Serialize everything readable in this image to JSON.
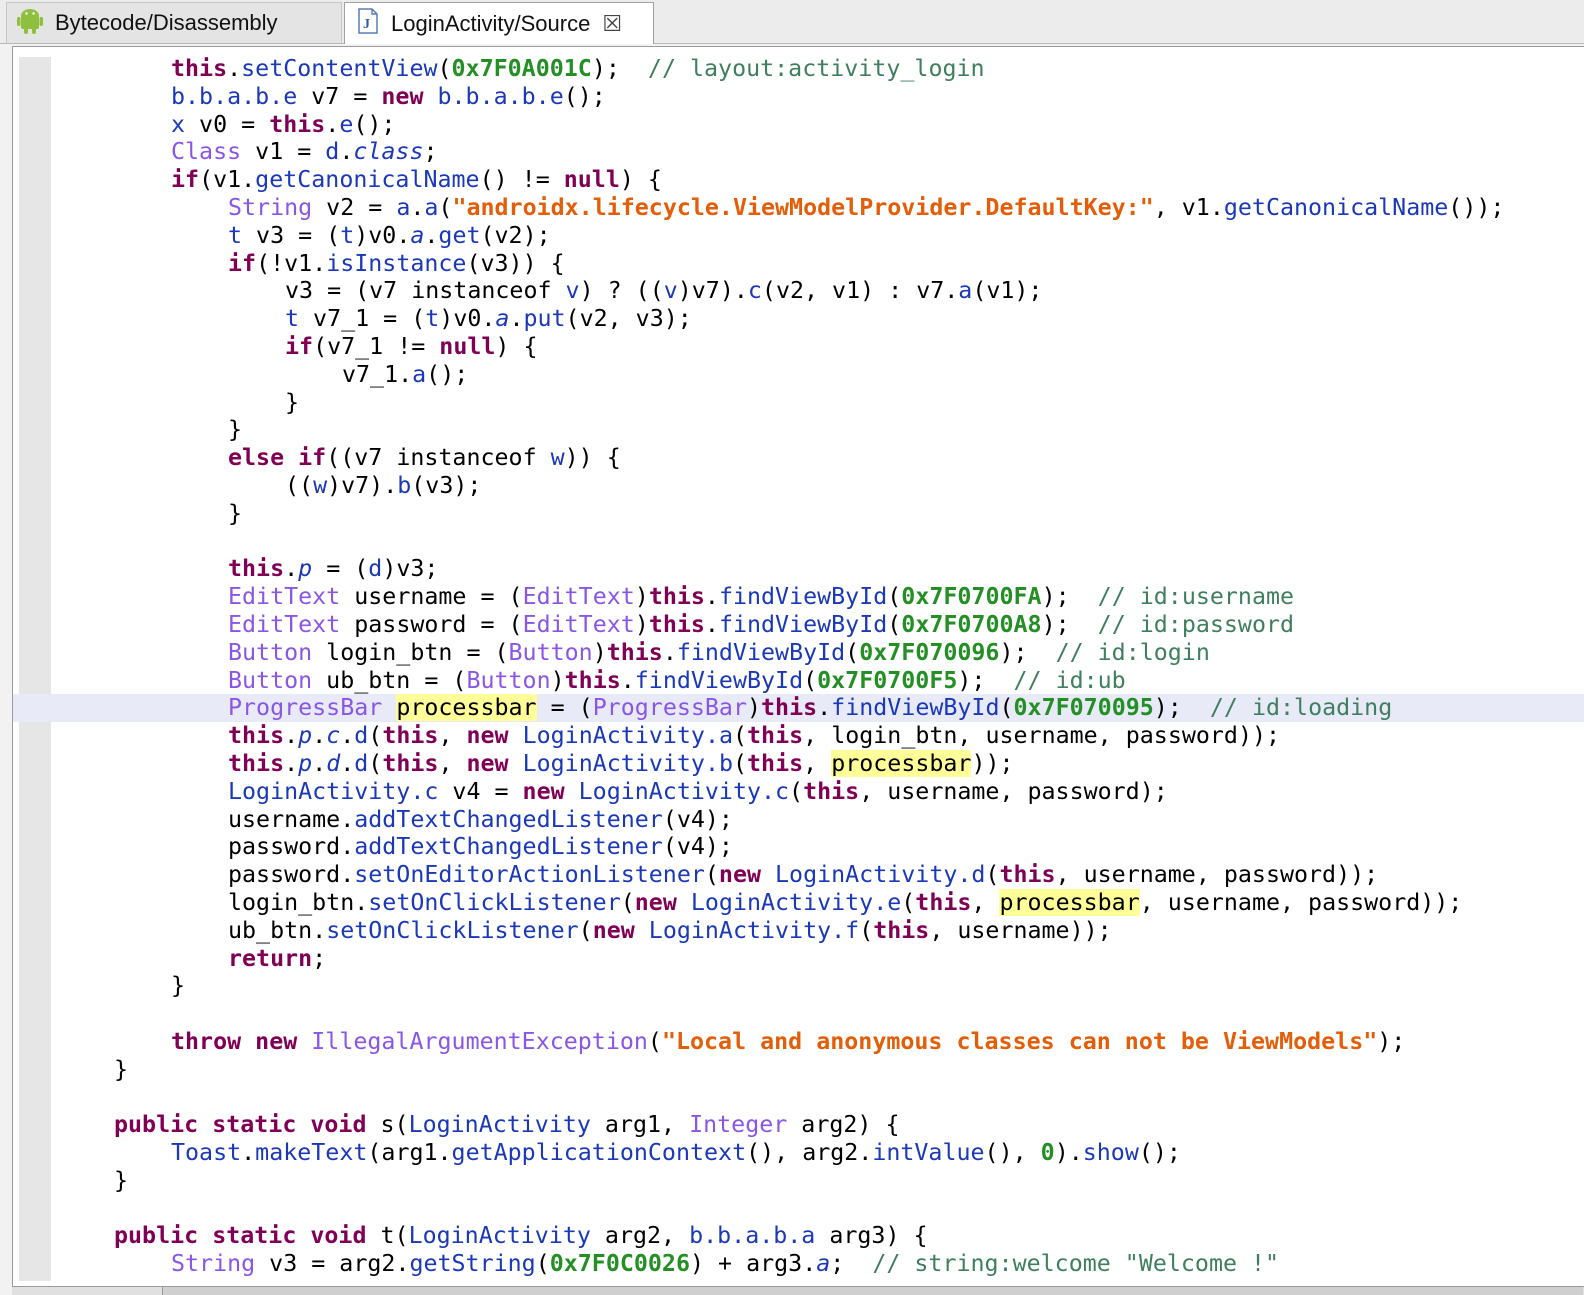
{
  "tabs": [
    {
      "label": "Bytecode/Disassembly",
      "icon": "android-icon",
      "active": false
    },
    {
      "label": "LoginActivity/Source",
      "icon": "java-file-icon",
      "active": true,
      "closable": true
    }
  ],
  "colors": {
    "keyword": "#7f0055",
    "type": "#8a56e6",
    "classref": "#1a38b8",
    "number": "#248f24",
    "string": "#e35e08",
    "comment": "#3f7f5f",
    "highlight": "#ffff99",
    "current_line": "#e8eaf8"
  },
  "code_lines": [
    {
      "indent": 2,
      "tokens": [
        [
          "kw",
          "this"
        ],
        [
          "t",
          "."
        ],
        [
          "m",
          "setContentView"
        ],
        [
          "t",
          "("
        ],
        [
          "num",
          "0x7F0A001C"
        ],
        [
          "t",
          ");  "
        ],
        [
          "cm",
          "// layout:activity_login"
        ]
      ]
    },
    {
      "indent": 2,
      "tokens": [
        [
          "cl",
          "b.b.a.b.e"
        ],
        [
          "t",
          " v7 = "
        ],
        [
          "kw",
          "new"
        ],
        [
          "t",
          " "
        ],
        [
          "cl",
          "b.b.a.b.e"
        ],
        [
          "t",
          "();"
        ]
      ]
    },
    {
      "indent": 2,
      "tokens": [
        [
          "cl",
          "x"
        ],
        [
          "t",
          " v0 = "
        ],
        [
          "kw",
          "this"
        ],
        [
          "t",
          "."
        ],
        [
          "m",
          "e"
        ],
        [
          "t",
          "();"
        ]
      ]
    },
    {
      "indent": 2,
      "tokens": [
        [
          "ty",
          "Class"
        ],
        [
          "t",
          " v1 = "
        ],
        [
          "cl",
          "d"
        ],
        [
          "t",
          "."
        ],
        [
          "fi",
          "class"
        ],
        [
          "t",
          ";"
        ]
      ]
    },
    {
      "indent": 2,
      "tokens": [
        [
          "kw",
          "if"
        ],
        [
          "t",
          "(v1."
        ],
        [
          "m",
          "getCanonicalName"
        ],
        [
          "t",
          "() != "
        ],
        [
          "kw",
          "null"
        ],
        [
          "t",
          ") {"
        ]
      ]
    },
    {
      "indent": 3,
      "tokens": [
        [
          "ty",
          "String"
        ],
        [
          "t",
          " v2 = "
        ],
        [
          "cl",
          "a"
        ],
        [
          "t",
          "."
        ],
        [
          "m",
          "a"
        ],
        [
          "t",
          "("
        ],
        [
          "str",
          "\"androidx.lifecycle.ViewModelProvider.DefaultKey:\""
        ],
        [
          "t",
          ", v1."
        ],
        [
          "m",
          "getCanonicalName"
        ],
        [
          "t",
          "());"
        ]
      ]
    },
    {
      "indent": 3,
      "tokens": [
        [
          "cl",
          "t"
        ],
        [
          "t",
          " v3 = ("
        ],
        [
          "cl",
          "t"
        ],
        [
          "t",
          ")v0."
        ],
        [
          "fi",
          "a"
        ],
        [
          "t",
          "."
        ],
        [
          "m",
          "get"
        ],
        [
          "t",
          "(v2);"
        ]
      ]
    },
    {
      "indent": 3,
      "tokens": [
        [
          "kw",
          "if"
        ],
        [
          "t",
          "(!v1."
        ],
        [
          "m",
          "isInstance"
        ],
        [
          "t",
          "(v3)) {"
        ]
      ]
    },
    {
      "indent": 4,
      "tokens": [
        [
          "t",
          "v3 = (v7 instanceof "
        ],
        [
          "cl",
          "v"
        ],
        [
          "t",
          ") ? (("
        ],
        [
          "cl",
          "v"
        ],
        [
          "t",
          ")v7)."
        ],
        [
          "m",
          "c"
        ],
        [
          "t",
          "(v2, v1) : v7."
        ],
        [
          "m",
          "a"
        ],
        [
          "t",
          "(v1);"
        ]
      ]
    },
    {
      "indent": 4,
      "tokens": [
        [
          "cl",
          "t"
        ],
        [
          "t",
          " v7_1 = ("
        ],
        [
          "cl",
          "t"
        ],
        [
          "t",
          ")v0."
        ],
        [
          "fi",
          "a"
        ],
        [
          "t",
          "."
        ],
        [
          "m",
          "put"
        ],
        [
          "t",
          "(v2, v3);"
        ]
      ]
    },
    {
      "indent": 4,
      "tokens": [
        [
          "kw",
          "if"
        ],
        [
          "t",
          "(v7_1 != "
        ],
        [
          "kw",
          "null"
        ],
        [
          "t",
          ") {"
        ]
      ]
    },
    {
      "indent": 5,
      "tokens": [
        [
          "t",
          "v7_1."
        ],
        [
          "m",
          "a"
        ],
        [
          "t",
          "();"
        ]
      ]
    },
    {
      "indent": 4,
      "tokens": [
        [
          "t",
          "}"
        ]
      ]
    },
    {
      "indent": 3,
      "tokens": [
        [
          "t",
          "}"
        ]
      ]
    },
    {
      "indent": 3,
      "tokens": [
        [
          "kw",
          "else"
        ],
        [
          "t",
          " "
        ],
        [
          "kw",
          "if"
        ],
        [
          "t",
          "((v7 instanceof "
        ],
        [
          "cl",
          "w"
        ],
        [
          "t",
          ")) {"
        ]
      ]
    },
    {
      "indent": 4,
      "tokens": [
        [
          "t",
          "(("
        ],
        [
          "cl",
          "w"
        ],
        [
          "t",
          ")v7)."
        ],
        [
          "m",
          "b"
        ],
        [
          "t",
          "(v3);"
        ]
      ]
    },
    {
      "indent": 3,
      "tokens": [
        [
          "t",
          "}"
        ]
      ]
    },
    {
      "indent": 0,
      "tokens": []
    },
    {
      "indent": 3,
      "tokens": [
        [
          "kw",
          "this"
        ],
        [
          "t",
          "."
        ],
        [
          "fi",
          "p"
        ],
        [
          "t",
          " = ("
        ],
        [
          "cl",
          "d"
        ],
        [
          "t",
          ")v3;"
        ]
      ]
    },
    {
      "indent": 3,
      "tokens": [
        [
          "ty",
          "EditText"
        ],
        [
          "t",
          " username = ("
        ],
        [
          "ty",
          "EditText"
        ],
        [
          "t",
          ")"
        ],
        [
          "kw",
          "this"
        ],
        [
          "t",
          "."
        ],
        [
          "m",
          "findViewById"
        ],
        [
          "t",
          "("
        ],
        [
          "num",
          "0x7F0700FA"
        ],
        [
          "t",
          ");  "
        ],
        [
          "cm",
          "// id:username"
        ]
      ]
    },
    {
      "indent": 3,
      "tokens": [
        [
          "ty",
          "EditText"
        ],
        [
          "t",
          " password = ("
        ],
        [
          "ty",
          "EditText"
        ],
        [
          "t",
          ")"
        ],
        [
          "kw",
          "this"
        ],
        [
          "t",
          "."
        ],
        [
          "m",
          "findViewById"
        ],
        [
          "t",
          "("
        ],
        [
          "num",
          "0x7F0700A8"
        ],
        [
          "t",
          ");  "
        ],
        [
          "cm",
          "// id:password"
        ]
      ]
    },
    {
      "indent": 3,
      "tokens": [
        [
          "ty",
          "Button"
        ],
        [
          "t",
          " login_btn = ("
        ],
        [
          "ty",
          "Button"
        ],
        [
          "t",
          ")"
        ],
        [
          "kw",
          "this"
        ],
        [
          "t",
          "."
        ],
        [
          "m",
          "findViewById"
        ],
        [
          "t",
          "("
        ],
        [
          "num",
          "0x7F070096"
        ],
        [
          "t",
          ");  "
        ],
        [
          "cm",
          "// id:login"
        ]
      ]
    },
    {
      "indent": 3,
      "tokens": [
        [
          "ty",
          "Button"
        ],
        [
          "t",
          " ub_btn = ("
        ],
        [
          "ty",
          "Button"
        ],
        [
          "t",
          ")"
        ],
        [
          "kw",
          "this"
        ],
        [
          "t",
          "."
        ],
        [
          "m",
          "findViewById"
        ],
        [
          "t",
          "("
        ],
        [
          "num",
          "0x7F0700F5"
        ],
        [
          "t",
          ");  "
        ],
        [
          "cm",
          "// id:ub"
        ]
      ]
    },
    {
      "indent": 3,
      "current": true,
      "tokens": [
        [
          "ty",
          "ProgressBar"
        ],
        [
          "t",
          " "
        ],
        [
          "caret",
          ""
        ],
        [
          "hl",
          "processbar"
        ],
        [
          "t",
          " = ("
        ],
        [
          "ty",
          "ProgressBar"
        ],
        [
          "t",
          ")"
        ],
        [
          "kw",
          "this"
        ],
        [
          "t",
          "."
        ],
        [
          "m",
          "findViewById"
        ],
        [
          "t",
          "("
        ],
        [
          "num",
          "0x7F070095"
        ],
        [
          "t",
          ");  "
        ],
        [
          "cm",
          "// id:loading"
        ]
      ]
    },
    {
      "indent": 3,
      "tokens": [
        [
          "kw",
          "this"
        ],
        [
          "t",
          "."
        ],
        [
          "fi",
          "p"
        ],
        [
          "t",
          "."
        ],
        [
          "fi",
          "c"
        ],
        [
          "t",
          "."
        ],
        [
          "m",
          "d"
        ],
        [
          "t",
          "("
        ],
        [
          "kw",
          "this"
        ],
        [
          "t",
          ", "
        ],
        [
          "kw",
          "new"
        ],
        [
          "t",
          " "
        ],
        [
          "cl",
          "LoginActivity.a"
        ],
        [
          "t",
          "("
        ],
        [
          "kw",
          "this"
        ],
        [
          "t",
          ", login_btn, username, password));"
        ]
      ]
    },
    {
      "indent": 3,
      "tokens": [
        [
          "kw",
          "this"
        ],
        [
          "t",
          "."
        ],
        [
          "fi",
          "p"
        ],
        [
          "t",
          "."
        ],
        [
          "fi",
          "d"
        ],
        [
          "t",
          "."
        ],
        [
          "m",
          "d"
        ],
        [
          "t",
          "("
        ],
        [
          "kw",
          "this"
        ],
        [
          "t",
          ", "
        ],
        [
          "kw",
          "new"
        ],
        [
          "t",
          " "
        ],
        [
          "cl",
          "LoginActivity.b"
        ],
        [
          "t",
          "("
        ],
        [
          "kw",
          "this"
        ],
        [
          "t",
          ", "
        ],
        [
          "hl",
          "processbar"
        ],
        [
          "t",
          "));"
        ]
      ]
    },
    {
      "indent": 3,
      "tokens": [
        [
          "cl",
          "LoginActivity.c"
        ],
        [
          "t",
          " v4 = "
        ],
        [
          "kw",
          "new"
        ],
        [
          "t",
          " "
        ],
        [
          "cl",
          "LoginActivity.c"
        ],
        [
          "t",
          "("
        ],
        [
          "kw",
          "this"
        ],
        [
          "t",
          ", username, password);"
        ]
      ]
    },
    {
      "indent": 3,
      "tokens": [
        [
          "t",
          "username."
        ],
        [
          "m",
          "addTextChangedListener"
        ],
        [
          "t",
          "(v4);"
        ]
      ]
    },
    {
      "indent": 3,
      "tokens": [
        [
          "t",
          "password."
        ],
        [
          "m",
          "addTextChangedListener"
        ],
        [
          "t",
          "(v4);"
        ]
      ]
    },
    {
      "indent": 3,
      "tokens": [
        [
          "t",
          "password."
        ],
        [
          "m",
          "setOnEditorActionListener"
        ],
        [
          "t",
          "("
        ],
        [
          "kw",
          "new"
        ],
        [
          "t",
          " "
        ],
        [
          "cl",
          "LoginActivity.d"
        ],
        [
          "t",
          "("
        ],
        [
          "kw",
          "this"
        ],
        [
          "t",
          ", username, password));"
        ]
      ]
    },
    {
      "indent": 3,
      "tokens": [
        [
          "t",
          "login_btn."
        ],
        [
          "m",
          "setOnClickListener"
        ],
        [
          "t",
          "("
        ],
        [
          "kw",
          "new"
        ],
        [
          "t",
          " "
        ],
        [
          "cl",
          "LoginActivity.e"
        ],
        [
          "t",
          "("
        ],
        [
          "kw",
          "this"
        ],
        [
          "t",
          ", "
        ],
        [
          "hl",
          "processbar"
        ],
        [
          "t",
          ", username, password));"
        ]
      ]
    },
    {
      "indent": 3,
      "tokens": [
        [
          "t",
          "ub_btn."
        ],
        [
          "m",
          "setOnClickListener"
        ],
        [
          "t",
          "("
        ],
        [
          "kw",
          "new"
        ],
        [
          "t",
          " "
        ],
        [
          "cl",
          "LoginActivity.f"
        ],
        [
          "t",
          "("
        ],
        [
          "kw",
          "this"
        ],
        [
          "t",
          ", username));"
        ]
      ]
    },
    {
      "indent": 3,
      "tokens": [
        [
          "kw",
          "return"
        ],
        [
          "t",
          ";"
        ]
      ]
    },
    {
      "indent": 2,
      "tokens": [
        [
          "t",
          "}"
        ]
      ]
    },
    {
      "indent": 0,
      "tokens": []
    },
    {
      "indent": 2,
      "tokens": [
        [
          "kw",
          "throw"
        ],
        [
          "t",
          " "
        ],
        [
          "kw",
          "new"
        ],
        [
          "t",
          " "
        ],
        [
          "ty",
          "IllegalArgumentException"
        ],
        [
          "t",
          "("
        ],
        [
          "str",
          "\"Local and anonymous classes can not be ViewModels\""
        ],
        [
          "t",
          ");"
        ]
      ]
    },
    {
      "indent": 1,
      "tokens": [
        [
          "t",
          "}"
        ]
      ]
    },
    {
      "indent": 0,
      "tokens": []
    },
    {
      "indent": 1,
      "tokens": [
        [
          "kw",
          "public"
        ],
        [
          "t",
          " "
        ],
        [
          "kw",
          "static"
        ],
        [
          "t",
          " "
        ],
        [
          "kw",
          "void"
        ],
        [
          "t",
          " s("
        ],
        [
          "cl",
          "LoginActivity"
        ],
        [
          "t",
          " arg1, "
        ],
        [
          "ty",
          "Integer"
        ],
        [
          "t",
          " arg2) {"
        ]
      ]
    },
    {
      "indent": 2,
      "tokens": [
        [
          "cl",
          "Toast"
        ],
        [
          "t",
          "."
        ],
        [
          "m",
          "makeText"
        ],
        [
          "t",
          "(arg1."
        ],
        [
          "m",
          "getApplicationContext"
        ],
        [
          "t",
          "(), arg2."
        ],
        [
          "m",
          "intValue"
        ],
        [
          "t",
          "(), "
        ],
        [
          "num",
          "0"
        ],
        [
          "t",
          ")."
        ],
        [
          "m",
          "show"
        ],
        [
          "t",
          "();"
        ]
      ]
    },
    {
      "indent": 1,
      "tokens": [
        [
          "t",
          "}"
        ]
      ]
    },
    {
      "indent": 0,
      "tokens": []
    },
    {
      "indent": 1,
      "tokens": [
        [
          "kw",
          "public"
        ],
        [
          "t",
          " "
        ],
        [
          "kw",
          "static"
        ],
        [
          "t",
          " "
        ],
        [
          "kw",
          "void"
        ],
        [
          "t",
          " t("
        ],
        [
          "cl",
          "LoginActivity"
        ],
        [
          "t",
          " arg2, "
        ],
        [
          "cl",
          "b.b.a.b.a"
        ],
        [
          "t",
          " arg3) {"
        ]
      ]
    },
    {
      "indent": 2,
      "tokens": [
        [
          "ty",
          "String"
        ],
        [
          "t",
          " v3 = arg2."
        ],
        [
          "m",
          "getString"
        ],
        [
          "t",
          "("
        ],
        [
          "num",
          "0x7F0C0026"
        ],
        [
          "t",
          ") + arg3."
        ],
        [
          "fi",
          "a"
        ],
        [
          "t",
          ";  "
        ],
        [
          "cm",
          "// string:welcome \"Welcome !\""
        ]
      ]
    }
  ]
}
